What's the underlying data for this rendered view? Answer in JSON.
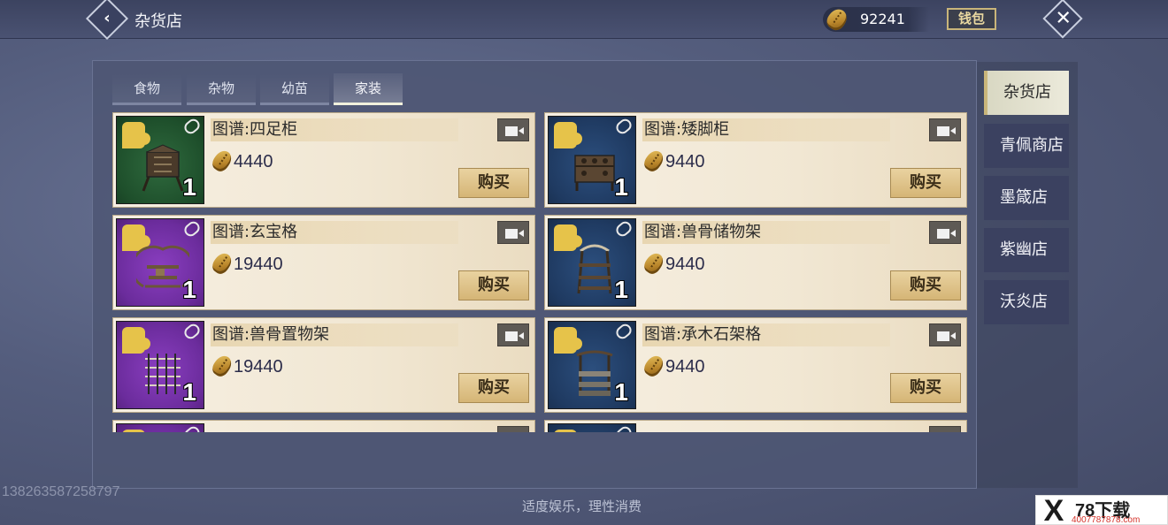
{
  "header": {
    "title": "杂货店",
    "currency_amount": "92241",
    "wallet_label": "钱包"
  },
  "tabs": [
    {
      "label": "食物",
      "active": false
    },
    {
      "label": "杂物",
      "active": false
    },
    {
      "label": "幼苗",
      "active": false
    },
    {
      "label": "家装",
      "active": true
    }
  ],
  "items": [
    {
      "name": "图谱:四足柜",
      "price": "4440",
      "qty": "1",
      "bg": "green",
      "buy_label": "购买"
    },
    {
      "name": "图谱:矮脚柜",
      "price": "9440",
      "qty": "1",
      "bg": "blue",
      "buy_label": "购买"
    },
    {
      "name": "图谱:玄宝格",
      "price": "19440",
      "qty": "1",
      "bg": "purple",
      "buy_label": "购买"
    },
    {
      "name": "图谱:兽骨储物架",
      "price": "9440",
      "qty": "1",
      "bg": "blue",
      "buy_label": "购买"
    },
    {
      "name": "图谱:兽骨置物架",
      "price": "19440",
      "qty": "1",
      "bg": "purple",
      "buy_label": "购买"
    },
    {
      "name": "图谱:承木石架格",
      "price": "9440",
      "qty": "1",
      "bg": "blue",
      "buy_label": "购买"
    }
  ],
  "shops": [
    {
      "label": "杂货店",
      "active": true
    },
    {
      "label": "青佩商店",
      "active": false
    },
    {
      "label": "墨箴店",
      "active": false
    },
    {
      "label": "紫幽店",
      "active": false
    },
    {
      "label": "沃炎店",
      "active": false
    }
  ],
  "footer_note": "适度娱乐，理性消费",
  "phone_watermark": "13826358725879​7",
  "site_watermark": {
    "logo": "X",
    "title": "78下载",
    "url": "4007787878.com"
  },
  "colors": {
    "card_bg": "#f3eadb",
    "buy_btn": "#dfc48d",
    "active_tab": "#f1f1dc"
  }
}
